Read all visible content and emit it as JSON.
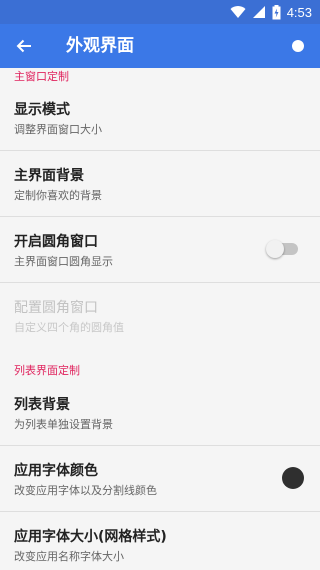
{
  "status_bar": {
    "time": "4:53",
    "icons": [
      "wifi-icon",
      "signal-icon",
      "battery-charging-icon"
    ]
  },
  "app_bar": {
    "title": "外观界面",
    "back_icon": "arrow-back-icon",
    "indicator": "white-dot-icon"
  },
  "sections": [
    {
      "header": "主窗口定制"
    },
    {
      "header": "列表界面定制"
    }
  ],
  "items": [
    {
      "title": "显示模式",
      "subtitle": "调整界面窗口大小"
    },
    {
      "title": "主界面背景",
      "subtitle": "定制你喜欢的背景"
    },
    {
      "title": "开启圆角窗口",
      "subtitle": "主界面窗口圆角显示",
      "toggle": false
    },
    {
      "title": "配置圆角窗口",
      "subtitle": "自定义四个角的圆角值",
      "enabled": false
    },
    {
      "title": "列表背景",
      "subtitle": "为列表单独设置背景"
    },
    {
      "title": "应用字体颜色",
      "subtitle": "改变应用字体以及分割线颜色",
      "color": "#2f2f2f"
    },
    {
      "title": "应用字体大小(网格样式)",
      "subtitle": "改变应用名称字体大小"
    }
  ],
  "colors": {
    "app_bar": "#3b78e7",
    "status_bar": "#3b6fd4",
    "section_header": "#e0245e"
  }
}
